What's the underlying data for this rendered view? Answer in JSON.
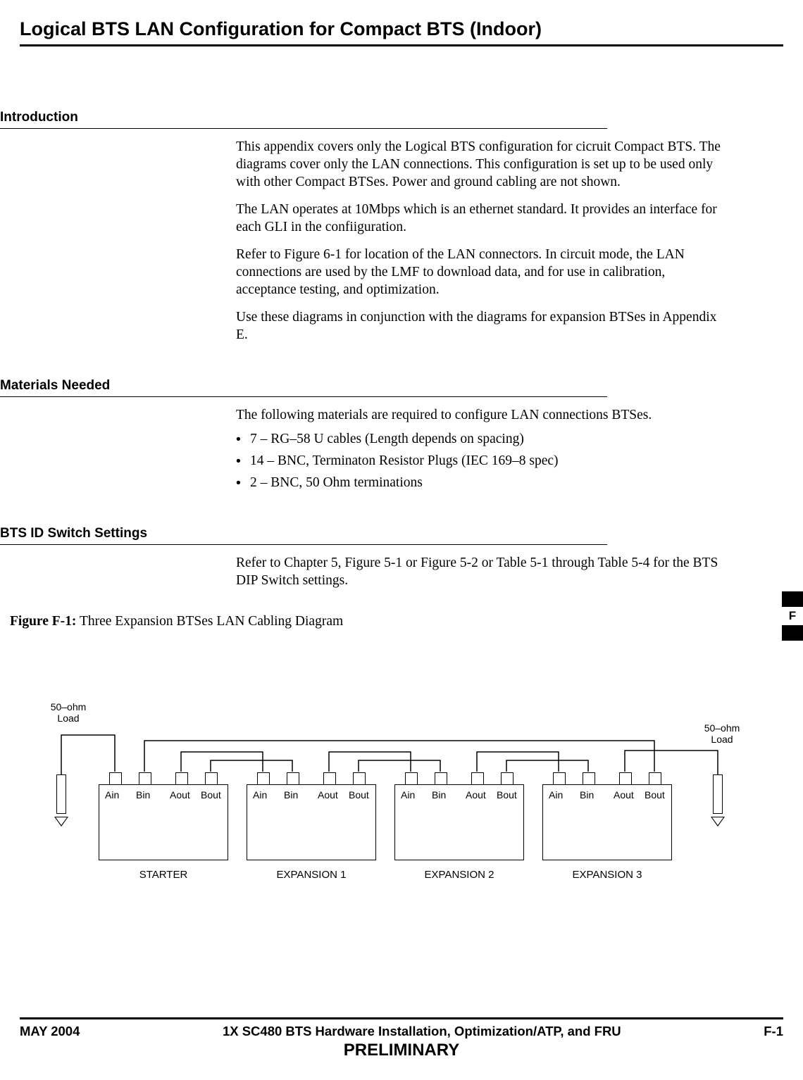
{
  "title": "Logical BTS LAN Configuration for Compact BTS (Indoor)",
  "sections": {
    "intro_heading": "Introduction",
    "intro_p1": "This appendix covers only the Logical BTS configuration for cicruit Compact BTS. The diagrams cover only the LAN connections. This configuration is set up to be used only with other Compact BTSes. Power and ground cabling are not shown.",
    "intro_p2": "The LAN operates at 10Mbps which is an ethernet standard. It provides an interface for each GLI in the confiiguration.",
    "intro_p3": "Refer to Figure 6-1 for location of the LAN connectors. In circuit mode, the LAN connections are used by the LMF to download data, and for use in calibration, acceptance testing, and optimization.",
    "intro_p4": "Use these diagrams in conjunction with the diagrams for expansion BTSes in Appendix E.",
    "materials_heading": "Materials Needed",
    "materials_p1": "The following materials are required to configure LAN connections BTSes.",
    "materials_items": [
      "7 – RG–58 U cables (Length depends on spacing)",
      "14 – BNC, Terminaton  Resistor Plugs (IEC 169–8 spec)",
      "2 – BNC, 50 Ohm terminations"
    ],
    "dip_heading": "BTS ID Switch Settings",
    "dip_p1": "Refer to Chapter 5, Figure 5-1 or Figure 5-2 or Table 5-1 through Table 5-4 for the BTS DIP Switch settings."
  },
  "figure": {
    "label": "Figure F-1:",
    "caption": "Three Expansion BTSes LAN Cabling Diagram",
    "ports": [
      "Ain",
      "Bin",
      "Aout",
      "Bout"
    ],
    "units": [
      "STARTER",
      "EXPANSION 1",
      "EXPANSION 2",
      "EXPANSION 3"
    ],
    "load_label_l1": "50–ohm",
    "load_label_l2": "Load"
  },
  "side_tab": "F",
  "footer": {
    "left": "MAY 2004",
    "center": "1X SC480 BTS Hardware Installation, Optimization/ATP, and FRU",
    "right": "F-1",
    "preliminary": "PRELIMINARY"
  }
}
